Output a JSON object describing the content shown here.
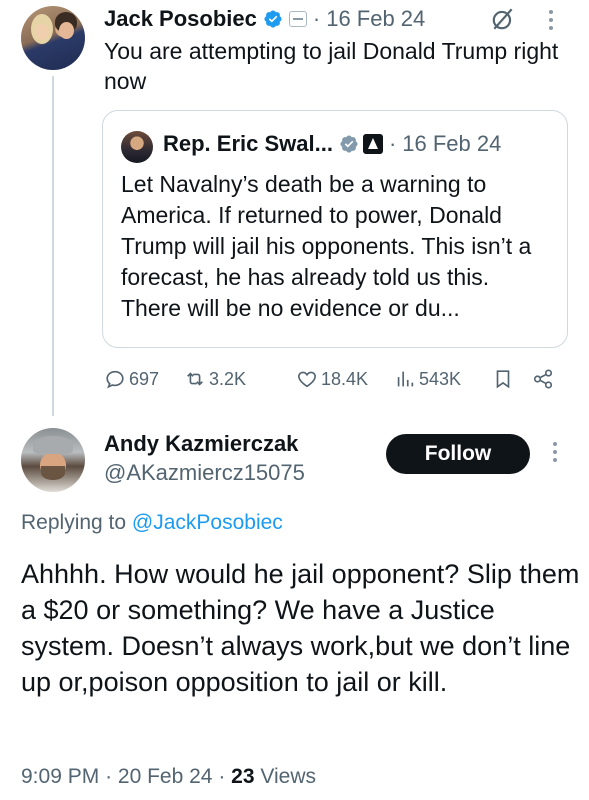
{
  "parent_tweet": {
    "author_name": "Jack Posobiec",
    "separator": "·",
    "date": "16 Feb 24",
    "text": "You are attempting to jail Donald Trump right now"
  },
  "quoted_tweet": {
    "author_name": "Rep. Eric Swal...",
    "separator": "·",
    "date": "16 Feb 24",
    "text": "Let Navalny’s death be a warning to America. If returned to power, Donald Trump will jail his opponents. This isn’t a forecast, he has already told us this. There will be no evidence or du..."
  },
  "actions": {
    "replies": "697",
    "reposts": "3.2K",
    "likes": "18.4K",
    "views": "543K"
  },
  "reply_tweet": {
    "author_name": "Andy Kazmierczak",
    "handle": "@AKazmiercz15075",
    "follow_label": "Follow",
    "replying_prefix": "Replying to",
    "replying_to": "@JackPosobiec",
    "text": "Ahhhh. How would he jail opponent? Slip them a $20 or something? We have a Justice system. Doesn’t always work,but we don’t line up or,poison opposition to jail or kill.",
    "time": "9:09 PM",
    "separator": "·",
    "date": "20 Feb 24",
    "views_count": "23",
    "views_label": "Views"
  },
  "colors": {
    "text": "#0f1419",
    "secondary": "#536471",
    "link": "#1d9bf0",
    "verified": "#1d9bf0",
    "border": "#cfd9de"
  },
  "icons": [
    "verified-badge-icon",
    "affiliate-badge-icon",
    "grok-icon",
    "more-icon",
    "government-badge-icon",
    "reply-icon",
    "repost-icon",
    "like-icon",
    "views-icon",
    "bookmark-icon",
    "share-icon"
  ]
}
